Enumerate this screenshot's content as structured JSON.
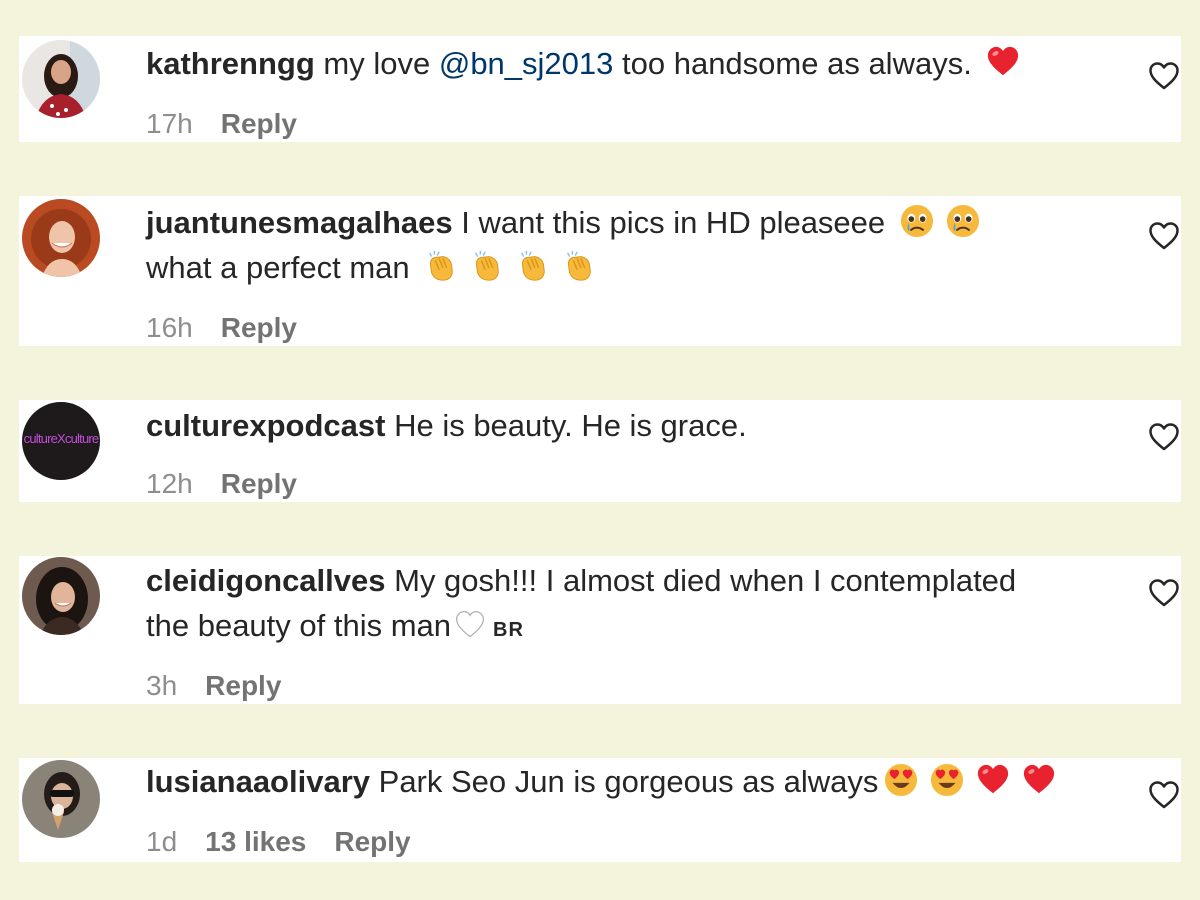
{
  "comments": [
    {
      "username": "kathrenngg",
      "text_before": "my love ",
      "mention": "@bn_sj2013",
      "text_after": " too handsome as always.",
      "emojis": [
        "red-heart"
      ],
      "time": "17h",
      "likes": "",
      "reply": "Reply"
    },
    {
      "username": "juantunesmagalhaes",
      "line1": "I want this pics in HD pleaseee",
      "line1_emojis": [
        "pleading-tear-face",
        "pleading-tear-face"
      ],
      "line2": "what a perfect man",
      "line2_emojis": [
        "clapping-hands",
        "clapping-hands",
        "clapping-hands",
        "clapping-hands"
      ],
      "time": "16h",
      "likes": "",
      "reply": "Reply"
    },
    {
      "username": "culturexpodcast",
      "text": "He is beauty. He is grace.",
      "avatar_text": "cultureXculture",
      "time": "12h",
      "likes": "",
      "reply": "Reply"
    },
    {
      "username": "cleidigoncallves",
      "line1": "My gosh!!! I almost died when I contemplated",
      "line2": "the beauty of this man",
      "line2_emojis": [
        "white-heart"
      ],
      "tag": "BR",
      "time": "3h",
      "likes": "",
      "reply": "Reply"
    },
    {
      "username": "lusianaaolivary",
      "text": "Park Seo Jun is gorgeous as always",
      "emojis": [
        "heart-eyes-face",
        "heart-eyes-face",
        "red-heart",
        "red-heart"
      ],
      "time": "1d",
      "likes": "13 likes",
      "reply": "Reply"
    }
  ],
  "colors": {
    "page_background": "#f4f4dc",
    "card_background": "#ffffff",
    "text": "#262626",
    "mention": "#00376b",
    "meta": "#8e8e8e"
  },
  "icons": {
    "like": "heart-outline-icon"
  }
}
